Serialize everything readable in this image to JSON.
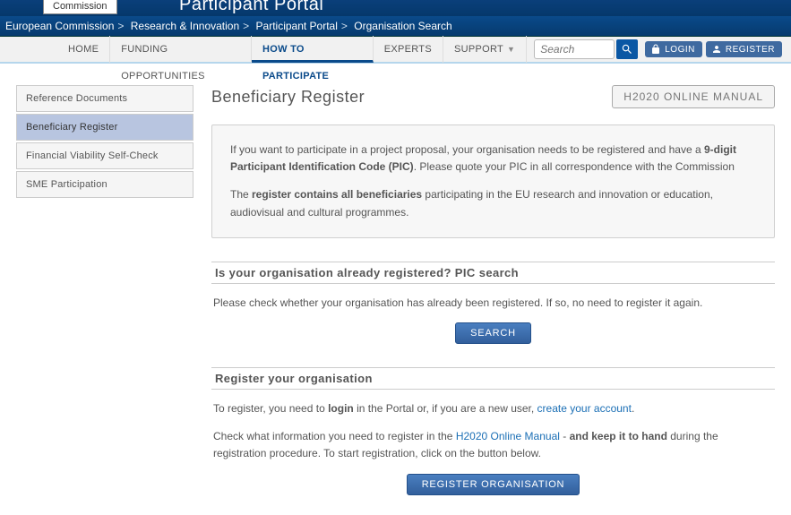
{
  "header": {
    "commission_label": "Commission",
    "portal_title": "Participant Portal"
  },
  "breadcrumb": {
    "items": [
      "European Commission",
      "Research & Innovation",
      "Participant Portal",
      "Organisation Search"
    ]
  },
  "nav": {
    "home": "HOME",
    "funding": "FUNDING OPPORTUNITIES",
    "howto": "HOW TO PARTICIPATE",
    "experts": "EXPERTS",
    "support": "SUPPORT"
  },
  "search": {
    "placeholder": "Search"
  },
  "auth": {
    "login": "LOGIN",
    "register": "REGISTER"
  },
  "sidebar": {
    "items": [
      {
        "label": "Reference Documents"
      },
      {
        "label": "Beneficiary Register"
      },
      {
        "label": "Financial Viability Self-Check"
      },
      {
        "label": "SME Participation"
      }
    ]
  },
  "main": {
    "title": "Beneficiary Register",
    "manual_button": "H2020 ONLINE MANUAL",
    "info": {
      "p1_pre": "If you want to participate in a project proposal, your organisation needs to be registered and have a ",
      "p1_bold": "9-digit Participant Identification Code (PIC)",
      "p1_post": ". Please quote your PIC in all correspondence with the Commission",
      "p2_pre": "The ",
      "p2_bold": "register contains all beneficiaries",
      "p2_post": " participating in the EU research and innovation or education, audiovisual and cultural programmes."
    },
    "section1": {
      "header": "Is your organisation already registered? PIC search",
      "text": "Please check whether your organisation has already been registered. If so, no need to register it again.",
      "button": "SEARCH"
    },
    "section2": {
      "header": "Register your organisation",
      "p1_pre": "To register, you need to ",
      "p1_bold": "login",
      "p1_mid": " in the Portal or, if you are a new user, ",
      "p1_link": "create your account",
      "p1_post": ".",
      "p2_pre": "Check what information you need to register in the ",
      "p2_link": "H2020 Online Manual",
      "p2_mid": " - ",
      "p2_bold": "and keep it to hand",
      "p2_post": " during the registration procedure. To start registration, click on the button below.",
      "button": "REGISTER ORGANISATION"
    }
  }
}
